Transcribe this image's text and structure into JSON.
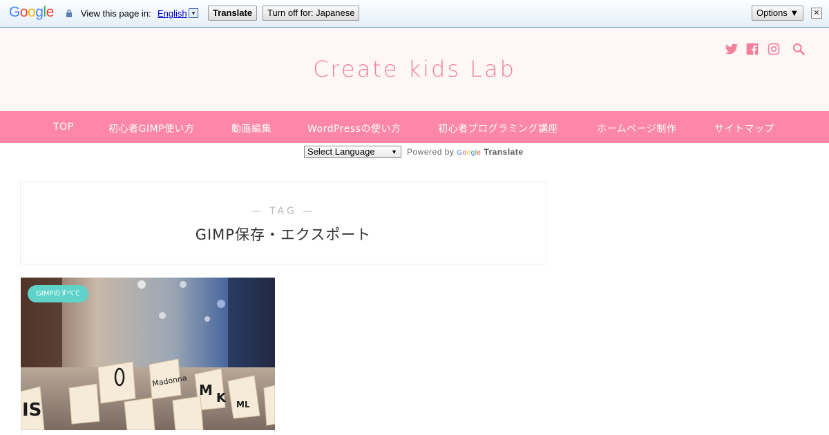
{
  "translate_bar": {
    "logo_letters": [
      "G",
      "o",
      "o",
      "g",
      "l",
      "e"
    ],
    "view_text": "View this page in:",
    "language": "English",
    "dropdown_arrow": "▾",
    "translate_button": "Translate",
    "turn_off_button": "Turn off for: Japanese",
    "options_button": "Options ▼",
    "close_glyph": "✕"
  },
  "header": {
    "site_title": "Create kids Lab",
    "icons": [
      "twitter-icon",
      "facebook-icon",
      "instagram-icon",
      "search-icon"
    ],
    "accent_color": "#f37f9e",
    "background_color": "#fff6f8"
  },
  "nav": {
    "background_color": "#fe86a6",
    "items": [
      "TOP",
      "初心者GIMP使い方",
      "動画編集",
      "WordPressの使い方",
      "初心者プログラミング講座",
      "ホームページ制作",
      "サイトマップ"
    ]
  },
  "language_widget": {
    "select_value": "Select Language",
    "select_arrow": "▼",
    "powered_by": "Powered by",
    "google_letters": [
      "G",
      "o",
      "o",
      "g",
      "l",
      "e"
    ],
    "translate_label": "Translate"
  },
  "tag_header": {
    "label": "— TAG —",
    "title": "GIMP保存・エクスポート"
  },
  "posts": [
    {
      "category": "GIMPのすべて",
      "category_color": "#5fd3c9"
    }
  ]
}
